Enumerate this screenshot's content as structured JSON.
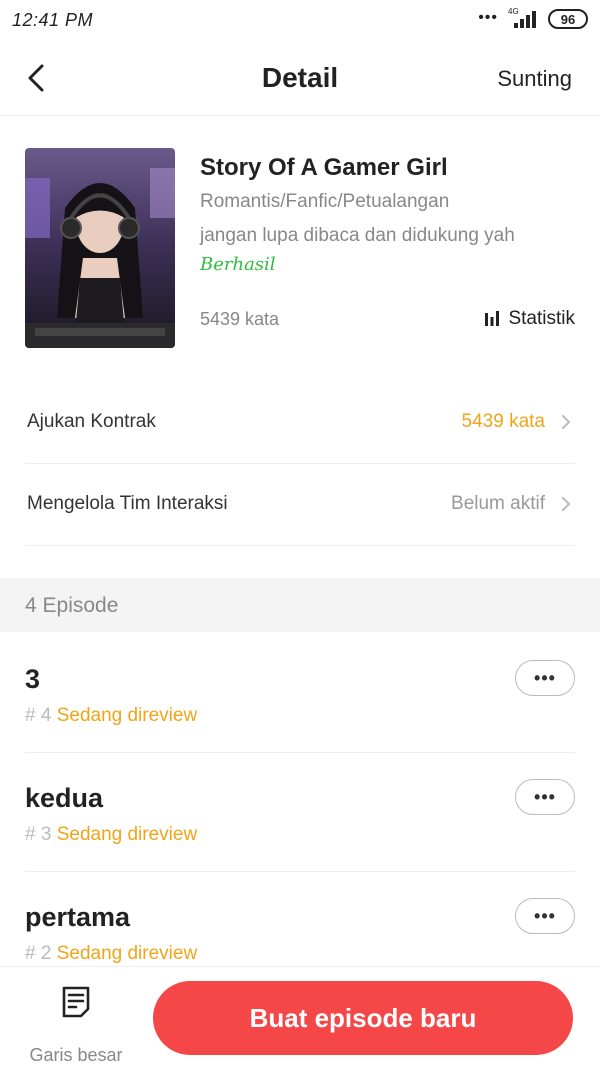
{
  "status_bar": {
    "time": "12:41 PM",
    "network": "4G",
    "battery": "96"
  },
  "header": {
    "title": "Detail",
    "edit_label": "Sunting"
  },
  "book": {
    "title": "Story Of A Gamer Girl",
    "genres": "Romantis/Fanfic/Petualangan",
    "description": "jangan lupa dibaca dan didukung yah",
    "status": "Berhasil",
    "word_count": "5439 kata",
    "stats_label": "Statistik"
  },
  "settings": [
    {
      "label": "Ajukan Kontrak",
      "value": "5439 kata",
      "value_color": "#f0a418"
    },
    {
      "label": "Mengelola Tim Interaksi",
      "value": "Belum aktif",
      "value_color": "#999999"
    }
  ],
  "episodes_header": "4 Episode",
  "episodes": [
    {
      "title": "3",
      "number": "# 4",
      "status": "Sedang direview"
    },
    {
      "title": "kedua",
      "number": "# 3",
      "status": "Sedang direview"
    },
    {
      "title": "pertama",
      "number": "# 2",
      "status": "Sedang direview"
    }
  ],
  "bottom": {
    "outline_label": "Garis besar",
    "create_label": "Buat episode baru"
  },
  "colors": {
    "accent": "#f54747",
    "success": "#2ebd3f",
    "pending": "#f0a418"
  }
}
